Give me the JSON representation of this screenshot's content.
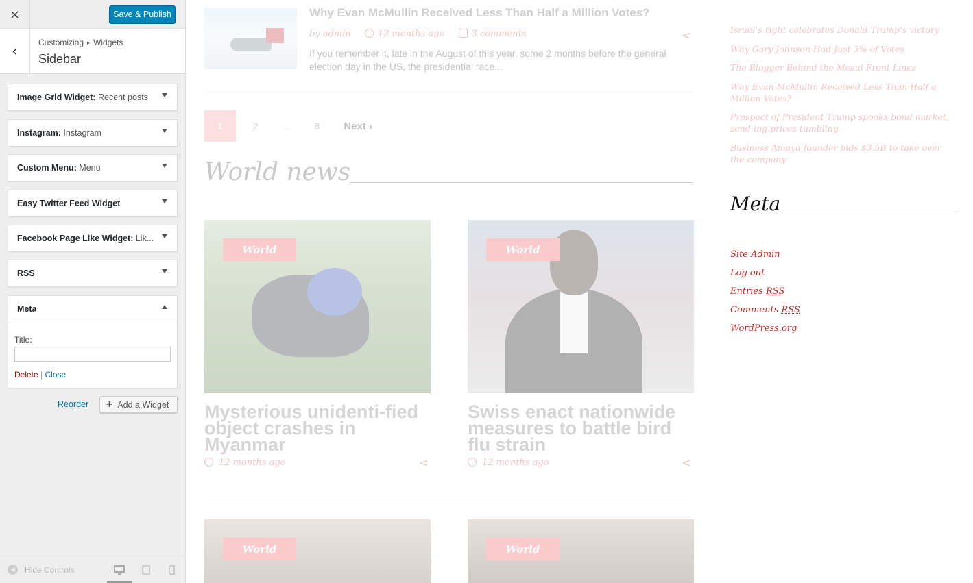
{
  "customizer": {
    "close_icon": "×",
    "publish_label": "Save & Publish",
    "back_icon": "‹",
    "breadcrumb": {
      "parent": "Customizing",
      "separator": "▸",
      "current": "Widgets"
    },
    "section_title": "Sidebar",
    "widgets": [
      {
        "title": "Image Grid Widget:",
        "subtitle": "Recent posts"
      },
      {
        "title": "Instagram:",
        "subtitle": "Instagram"
      },
      {
        "title": "Custom Menu:",
        "subtitle": "Menu"
      },
      {
        "title": "Easy Twitter Feed Widget",
        "subtitle": ""
      },
      {
        "title": "Facebook Page Like Widget:",
        "subtitle": "Lik..."
      },
      {
        "title": "RSS",
        "subtitle": ""
      },
      {
        "title": "Meta",
        "subtitle": ""
      }
    ],
    "meta_form": {
      "title_label": "Title:",
      "title_value": "",
      "delete_label": "Delete",
      "divider": "|",
      "close_label": "Close"
    },
    "reorder_label": "Reorder",
    "add_widget_label": "Add a Widget",
    "add_widget_icon": "+",
    "hide_controls_label": "Hide Controls",
    "accent_color": "#0085ba"
  },
  "preview": {
    "featured_post": {
      "title": "Why Evan McMullin Received Less Than Half a Million Votes?",
      "by": "by",
      "author": "admin",
      "date": "12 months ago",
      "comments": "3 comments",
      "excerpt": "If you remember it, late in the August of this year, some 2 months before the general election day in the US, the presidential race..."
    },
    "pagination": {
      "current": "1",
      "p2": "2",
      "dots": "...",
      "last": "8",
      "next": "Next ›"
    },
    "world_heading": "World news",
    "cards": [
      {
        "tag": "World",
        "title": "Mysterious unidenti-fied object crashes in Myanmar",
        "date": "12 months ago"
      },
      {
        "tag": "World",
        "title": "Swiss enact nationwide measures to battle bird flu strain",
        "date": "12 months ago"
      },
      {
        "tag": "World"
      },
      {
        "tag": "World"
      }
    ],
    "recent_posts": [
      "Israel’s right celebrates Donald Trump’s victory",
      "Why Gary Johnson Had Just 3% of Votes",
      "The Blogger Behind the Mosul Front Lines",
      "Why Evan McMullin Received Less Than Half a Million Votes?",
      "Prospect of President Trump spooks bond market, send-ing prices tumbling",
      "Business Amaya founder bids $3.5B to take over the company"
    ],
    "meta_heading": "Meta",
    "meta_links": {
      "site_admin": "Site Admin",
      "log_out": "Log out",
      "entries": "Entries",
      "comments": "Comments",
      "rss": "RSS",
      "wordpress": "WordPress.org"
    },
    "accent_color": "#e05555"
  }
}
